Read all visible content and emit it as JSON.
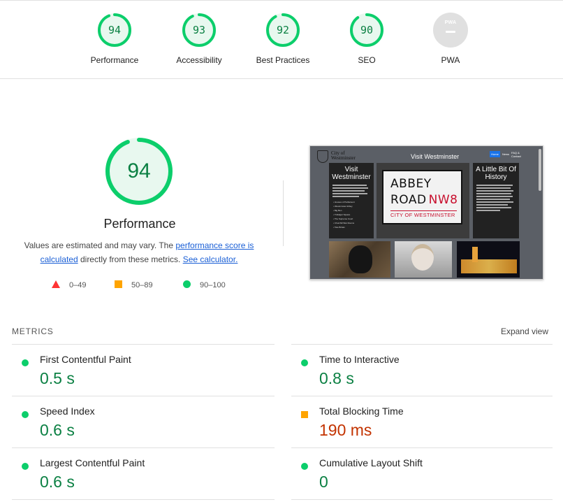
{
  "categories": [
    {
      "label": "Performance",
      "score": "94"
    },
    {
      "label": "Accessibility",
      "score": "93"
    },
    {
      "label": "Best Practices",
      "score": "92"
    },
    {
      "label": "SEO",
      "score": "90"
    },
    {
      "label": "PWA",
      "score": "PWA"
    }
  ],
  "main": {
    "score": "94",
    "title": "Performance",
    "desc_prefix": "Values are estimated and may vary. The ",
    "desc_link1": "performance score is calculated",
    "desc_middle": " directly from these metrics. ",
    "desc_link2": "See calculator."
  },
  "legend": [
    {
      "range": "0–49",
      "color": "#ff3333"
    },
    {
      "range": "50–89",
      "color": "#ffa400"
    },
    {
      "range": "90–100",
      "color": "#0cce6b"
    }
  ],
  "screenshot": {
    "site_logo_line1": "City of",
    "site_logo_line2": "Westminster",
    "site_title": "Visit Westminster",
    "nav_home": "Home",
    "nav_news": "News",
    "nav_faq": "FAQ &",
    "nav_contact": "Contact",
    "card1_title": "Visit Westminster",
    "card1_list": [
      "Houses of Parliament",
      "Westminster Abbey",
      "Big Ben",
      "Trafalgar Square",
      "The Supreme Court",
      "Churchill War Rooms",
      "Tate Britain"
    ],
    "card2_title": "A Little Bit Of History",
    "sign_line1": "ABBEY",
    "sign_line2": "ROAD",
    "sign_code": "NW8",
    "sign_city": "CITY OF WESTMINSTER"
  },
  "metrics": {
    "heading": "METRICS",
    "expand_label": "Expand view",
    "items": [
      {
        "name": "First Contentful Paint",
        "value": "0.5 s",
        "status": "pass"
      },
      {
        "name": "Time to Interactive",
        "value": "0.8 s",
        "status": "pass"
      },
      {
        "name": "Speed Index",
        "value": "0.6 s",
        "status": "pass"
      },
      {
        "name": "Total Blocking Time",
        "value": "190 ms",
        "status": "average"
      },
      {
        "name": "Largest Contentful Paint",
        "value": "0.6 s",
        "status": "pass"
      },
      {
        "name": "Cumulative Layout Shift",
        "value": "0",
        "status": "pass"
      }
    ]
  },
  "colors": {
    "pass": "#0cce6b",
    "pass_text": "#0b8043",
    "average": "#ffa400",
    "average_text": "#c33300",
    "fail": "#ff3333",
    "link": "#1a5fd6"
  }
}
